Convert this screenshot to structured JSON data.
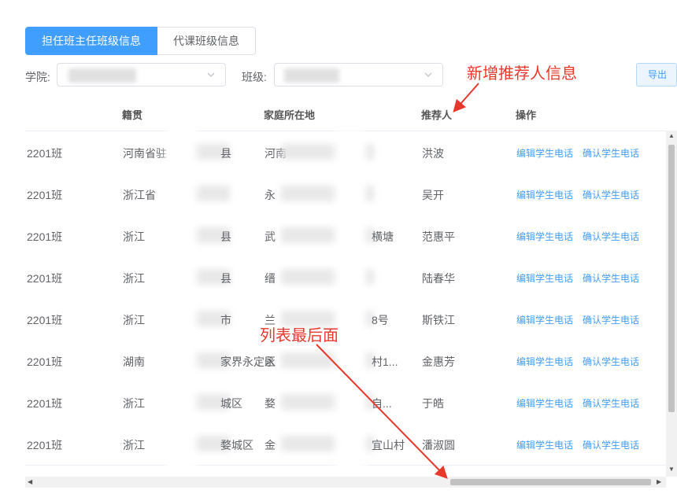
{
  "tabs": [
    {
      "label": "担任班主任班级信息",
      "active": true
    },
    {
      "label": "代课班级信息",
      "active": false
    }
  ],
  "filters": {
    "college_label": "学院:",
    "college_value": "",
    "class_label": "班级:",
    "class_value": ""
  },
  "toolbar": {
    "export_label": "导出"
  },
  "annotations": {
    "new_field": "新增推荐人信息",
    "list_end": "列表最后面"
  },
  "table": {
    "columns": [
      "籍贯",
      "家庭所在地",
      "推荐人",
      "操作"
    ],
    "actions": [
      "编辑学生电话",
      "确认学生电话"
    ],
    "rows": [
      {
        "class": "2201班",
        "native": "河南省驻",
        "native_tail": "县",
        "home": "河南",
        "home_tail": "",
        "referrer": "洪波"
      },
      {
        "class": "2201班",
        "native": "浙江省",
        "native_tail": "",
        "home": "永",
        "home_tail": "",
        "referrer": "吴开"
      },
      {
        "class": "2201班",
        "native": "浙江",
        "native_tail": "县",
        "home": "武",
        "home_tail": "横塘",
        "referrer": "范惠平"
      },
      {
        "class": "2201班",
        "native": "浙江",
        "native_tail": "县",
        "home": "缙",
        "home_tail": "",
        "referrer": "陆春华"
      },
      {
        "class": "2201班",
        "native": "浙江",
        "native_tail": "市",
        "home": "兰",
        "home_tail": "8号",
        "referrer": "斯铁江"
      },
      {
        "class": "2201班",
        "native": "湖南",
        "native_tail": "家界永定区",
        "home": "永",
        "home_tail": "村1...",
        "referrer": "金惠芳"
      },
      {
        "class": "2201班",
        "native": "浙江",
        "native_tail": "城区",
        "home": "婺",
        "home_tail": "自...",
        "referrer": "于皓"
      },
      {
        "class": "2201班",
        "native": "浙江",
        "native_tail": "婺城区",
        "home": "金",
        "home_tail": "宜山村",
        "referrer": "潘淑圆"
      }
    ]
  },
  "colors": {
    "primary": "#409eff",
    "annotation": "#e8382c",
    "border": "#ebeef5"
  }
}
